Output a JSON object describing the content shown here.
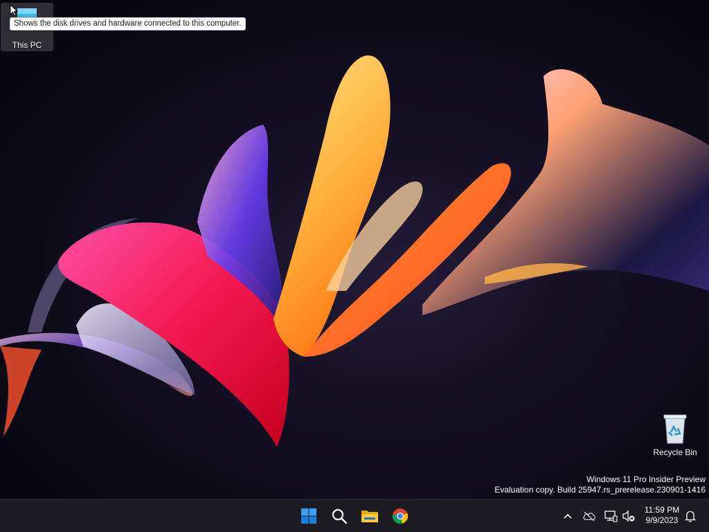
{
  "desktop": {
    "icons": [
      {
        "label": "This PC",
        "icon": "monitor-icon"
      },
      {
        "label": "Recycle Bin",
        "icon": "recycle-bin-icon"
      }
    ],
    "tooltip": "Shows the disk drives and hardware connected to this computer.",
    "watermark": {
      "line1": "Windows 11 Pro Insider Preview",
      "line2": "Evaluation copy. Build 25947.rs_prerelease.230901-1416"
    }
  },
  "taskbar": {
    "apps": [
      {
        "name": "Start",
        "icon": "windows-start-icon"
      },
      {
        "name": "Search",
        "icon": "search-icon"
      },
      {
        "name": "File Explorer",
        "icon": "folder-icon"
      },
      {
        "name": "Google Chrome",
        "icon": "chrome-icon"
      }
    ],
    "tray": {
      "icons": [
        "chevron-up-icon",
        "cloud-offline-icon",
        "network-icon",
        "speaker-muted-icon",
        "bell-icon"
      ],
      "time": "11:59 PM",
      "date": "9/9/2023"
    }
  },
  "colors": {
    "taskbar_bg": "#1c1b22",
    "accent": "#0078d4"
  }
}
